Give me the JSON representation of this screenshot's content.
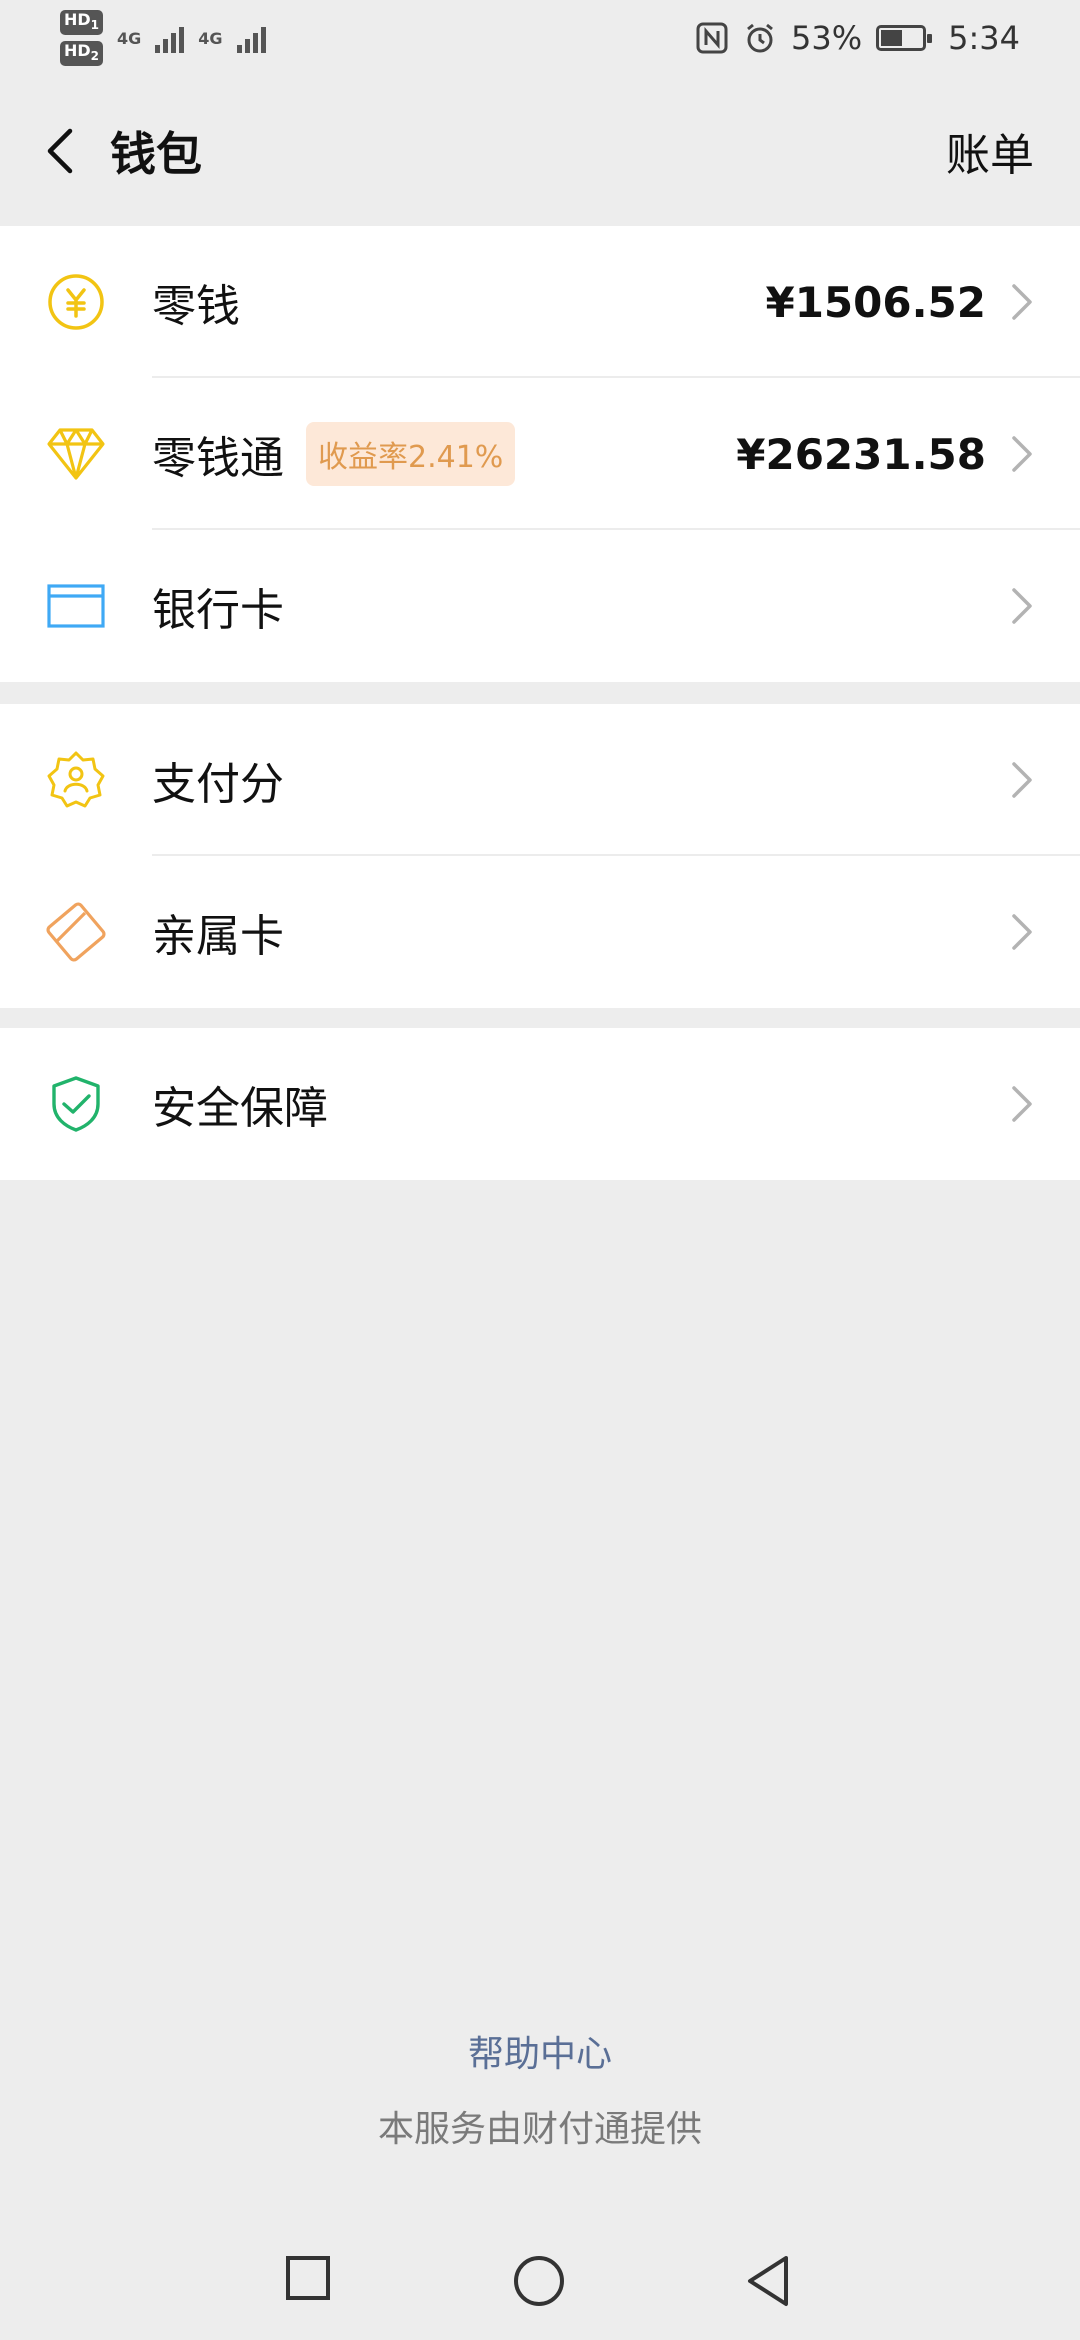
{
  "status": {
    "sim1": "HD",
    "sim1_slot": "1",
    "sim2": "HD",
    "sim2_slot": "2",
    "network1": "4G",
    "network2": "4G",
    "battery": "53%",
    "battery_level": 0.53,
    "time": "5:34"
  },
  "header": {
    "title": "钱包",
    "bill_label": "账单"
  },
  "groups": [
    {
      "items": [
        {
          "label": "零钱",
          "amount": "¥1506.52",
          "icon": "yuan-coin-icon",
          "color": "#f2c413"
        },
        {
          "label": "零钱通",
          "badge": "收益率2.41%",
          "amount": "¥26231.58",
          "icon": "diamond-icon",
          "color": "#f2c413"
        },
        {
          "label": "银行卡",
          "icon": "bank-card-icon",
          "color": "#3fa9f5"
        }
      ]
    },
    {
      "items": [
        {
          "label": "支付分",
          "icon": "payment-score-icon",
          "color": "#f2c413"
        },
        {
          "label": "亲属卡",
          "icon": "family-card-icon",
          "color": "#f0a35e"
        }
      ]
    },
    {
      "items": [
        {
          "label": "安全保障",
          "icon": "shield-check-icon",
          "color": "#21b36b"
        }
      ]
    }
  ],
  "footer": {
    "help_center": "帮助中心",
    "provider": "本服务由财付通提供"
  }
}
